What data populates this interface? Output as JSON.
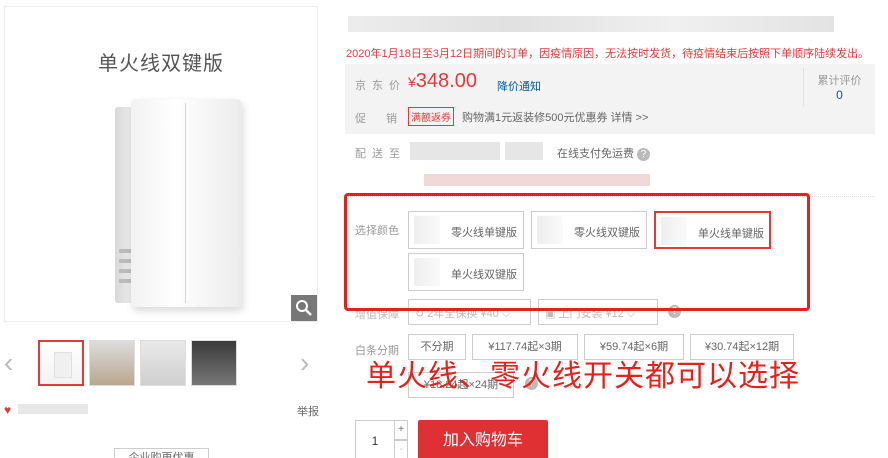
{
  "gallery": {
    "image_caption": "单火线双键版",
    "zoom_icon": "magnifier-icon",
    "thumb_count": 4,
    "prev_icon": "chevron-left-icon",
    "next_icon": "chevron-right-icon",
    "report_label": "举报",
    "enterprise_label": "企业购更优惠"
  },
  "notice": "2020年1月18日至3月12日期间的订单，因疫情原因，无法按时发货，待疫情结束后按照下单顺序陆续发出。",
  "summary": {
    "price_label": "京东价",
    "currency": "¥",
    "price": "348.00",
    "price_notice": "降价通知",
    "review_label": "累计评价",
    "review_count": "0",
    "promo_label": "促销",
    "promo_badge": "满额返券",
    "promo_text": "购物满1元返装修500元优惠券 详情 >>"
  },
  "delivery": {
    "label": "配送至",
    "fee_text": "在线支付免运费"
  },
  "selection": {
    "label": "选择颜色",
    "options": [
      {
        "label": "零火线单键版",
        "selected": false
      },
      {
        "label": "零火线双键版",
        "selected": false
      },
      {
        "label": "单火线单键版",
        "selected": true
      },
      {
        "label": "单火线双键版",
        "selected": false
      }
    ]
  },
  "installment": {
    "label": "白条分期",
    "options": [
      "不分期",
      "¥117.74起×3期",
      "¥59.74起×6期",
      "¥30.74起×12期",
      "¥18.24起×24期"
    ]
  },
  "overlay_caption": "单火线、零火线开关都可以选择",
  "purchase": {
    "quantity": "1",
    "plus": "+",
    "minus": "-",
    "add_to_cart": "加入购物车"
  },
  "colors": {
    "accent": "#e4393c",
    "frame": "#e8201b",
    "link": "#005aa0"
  }
}
